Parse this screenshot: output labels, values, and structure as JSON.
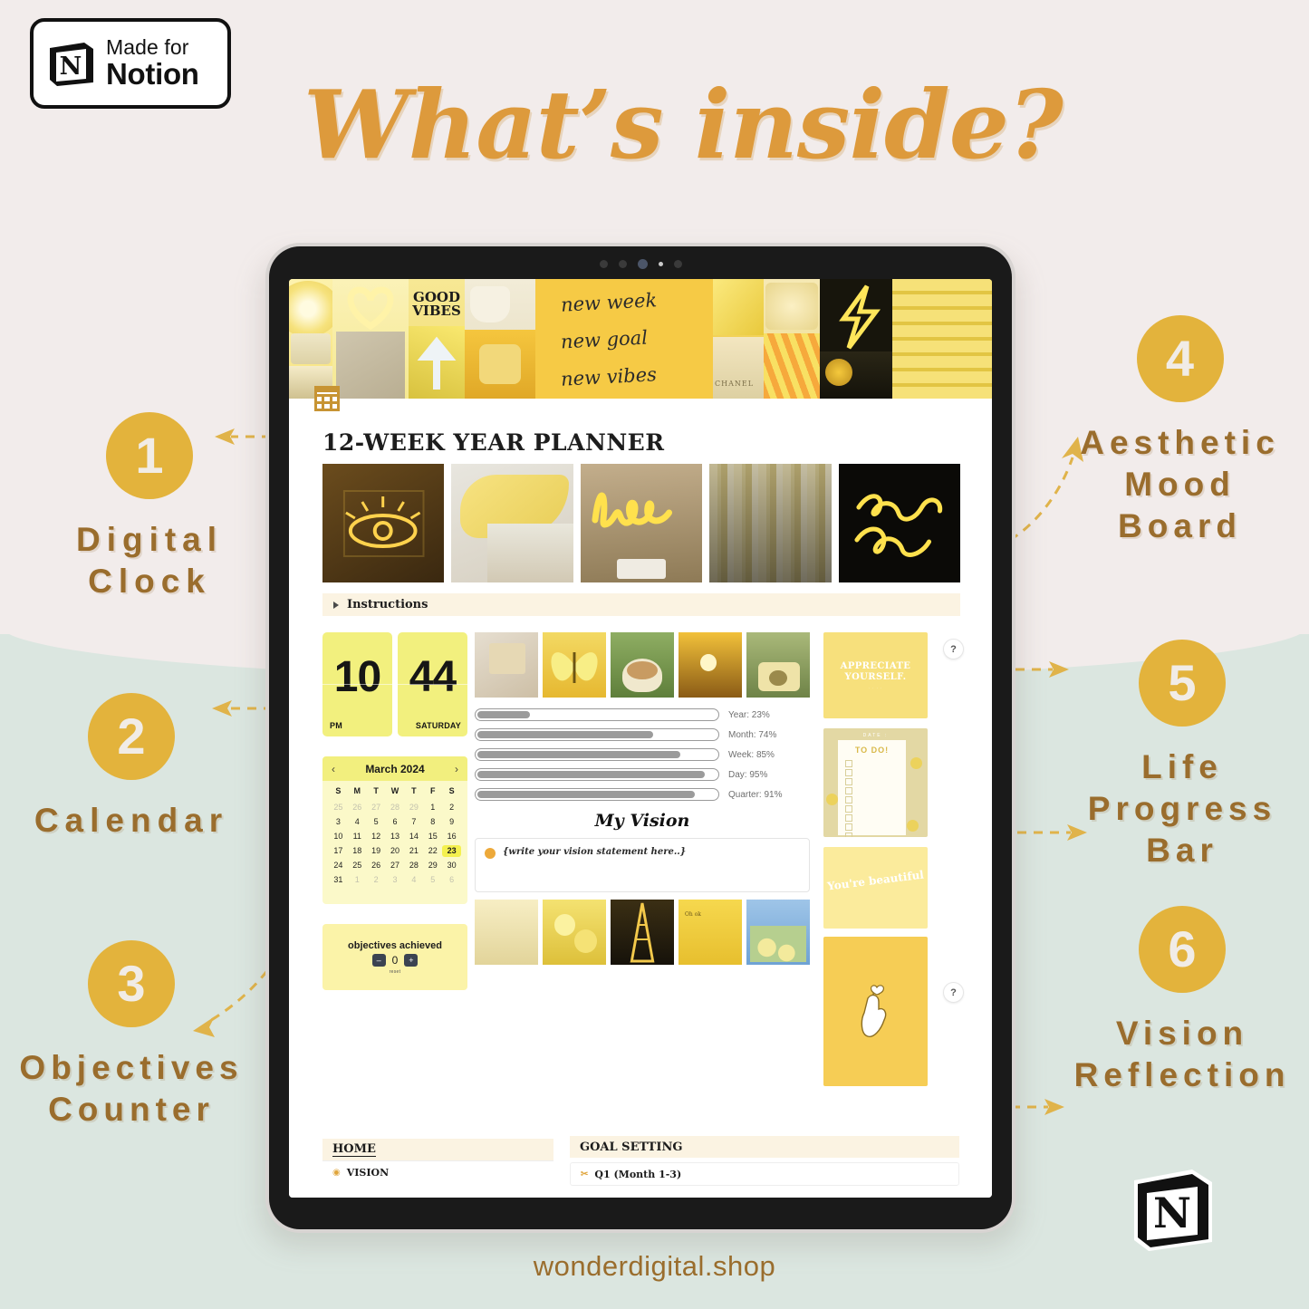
{
  "badge": {
    "made_for": "Made for",
    "notion": "Notion",
    "cube_letter": "N"
  },
  "header": {
    "title": "What’s inside?",
    "title_color": "#dd9a3c"
  },
  "theme": {
    "bg_top": "#f2eceb",
    "bg_bottom": "#dbe6e0",
    "accent": "#e3b33c",
    "label_brown": "#9a6d2d",
    "yellow": "#f2ef7e"
  },
  "callouts": [
    {
      "number": "1",
      "label_line1": "Digital",
      "label_line2": "Clock"
    },
    {
      "number": "2",
      "label_line1": "Calendar",
      "label_line2": ""
    },
    {
      "number": "3",
      "label_line1": "Objectives",
      "label_line2": "Counter"
    },
    {
      "number": "4",
      "label_line1": "Aesthetic",
      "label_line2": "Mood",
      "label_line3": "Board"
    },
    {
      "number": "5",
      "label_line1": "Life",
      "label_line2": "Progress",
      "label_line3": "Bar"
    },
    {
      "number": "6",
      "label_line1": "Vision",
      "label_line2": "Reflection"
    }
  ],
  "tablet": {
    "moodboard": {
      "good_vibes_line1": "GOOD",
      "good_vibes_line2": "VIBES",
      "quote_line1": "new week",
      "quote_line2": "new goal",
      "quote_line3": "new vibes",
      "chanel_label": "CHANEL"
    },
    "page": {
      "title": "12-WEEK  YEAR PLANNER",
      "instructions_label": "Instructions",
      "clock": {
        "hour": "10",
        "minute": "44",
        "meridiem": "PM",
        "weekday": "SATURDAY"
      },
      "calendar": {
        "month": "March 2024",
        "prev": "‹",
        "next": "›",
        "dow": [
          "S",
          "M",
          "T",
          "W",
          "T",
          "F",
          "S"
        ],
        "weeks": [
          [
            {
              "d": "25",
              "m": true
            },
            {
              "d": "26",
              "m": true
            },
            {
              "d": "27",
              "m": true
            },
            {
              "d": "28",
              "m": true
            },
            {
              "d": "29",
              "m": true
            },
            {
              "d": "1"
            },
            {
              "d": "2"
            }
          ],
          [
            {
              "d": "3"
            },
            {
              "d": "4"
            },
            {
              "d": "5"
            },
            {
              "d": "6"
            },
            {
              "d": "7"
            },
            {
              "d": "8"
            },
            {
              "d": "9"
            }
          ],
          [
            {
              "d": "10"
            },
            {
              "d": "11"
            },
            {
              "d": "12"
            },
            {
              "d": "13"
            },
            {
              "d": "14"
            },
            {
              "d": "15"
            },
            {
              "d": "16"
            }
          ],
          [
            {
              "d": "17"
            },
            {
              "d": "18"
            },
            {
              "d": "19"
            },
            {
              "d": "20"
            },
            {
              "d": "21"
            },
            {
              "d": "22"
            },
            {
              "d": "23",
              "today": true
            }
          ],
          [
            {
              "d": "24"
            },
            {
              "d": "25"
            },
            {
              "d": "26"
            },
            {
              "d": "27"
            },
            {
              "d": "28"
            },
            {
              "d": "29"
            },
            {
              "d": "30"
            }
          ],
          [
            {
              "d": "31"
            },
            {
              "d": "1",
              "m": true
            },
            {
              "d": "2",
              "m": true
            },
            {
              "d": "3",
              "m": true
            },
            {
              "d": "4",
              "m": true
            },
            {
              "d": "5",
              "m": true
            },
            {
              "d": "6",
              "m": true
            }
          ]
        ]
      },
      "objectives": {
        "title": "objectives achieved",
        "value": "0",
        "minus": "–",
        "plus": "+",
        "reset": "reset"
      },
      "progress": [
        {
          "label": "Year: 23%",
          "value": 23
        },
        {
          "label": "Month: 74%",
          "value": 74
        },
        {
          "label": "Week: 85%",
          "value": 85
        },
        {
          "label": "Day: 95%",
          "value": 95
        },
        {
          "label": "Quarter: 91%",
          "value": 91
        }
      ],
      "vision": {
        "heading": "My Vision",
        "placeholder": "{write your vision statement here..}"
      },
      "widgets": {
        "appreciate_line1": "APPRECIATE",
        "appreciate_line2": "YOURSELF.",
        "appreciate_sub": "· · · ·",
        "todo_date": "DATE :",
        "todo_title": "TO DO!",
        "beautiful": "You're beautiful",
        "help": "?"
      },
      "footer_blocks": [
        {
          "header": "HOME",
          "item_icon": "◉",
          "item": "VISION"
        },
        {
          "header": "GOAL SETTING",
          "item_icon": "✂",
          "item": "Q1 (Month 1-3)"
        }
      ]
    }
  },
  "footer": {
    "url": "wonderdigital.shop"
  }
}
